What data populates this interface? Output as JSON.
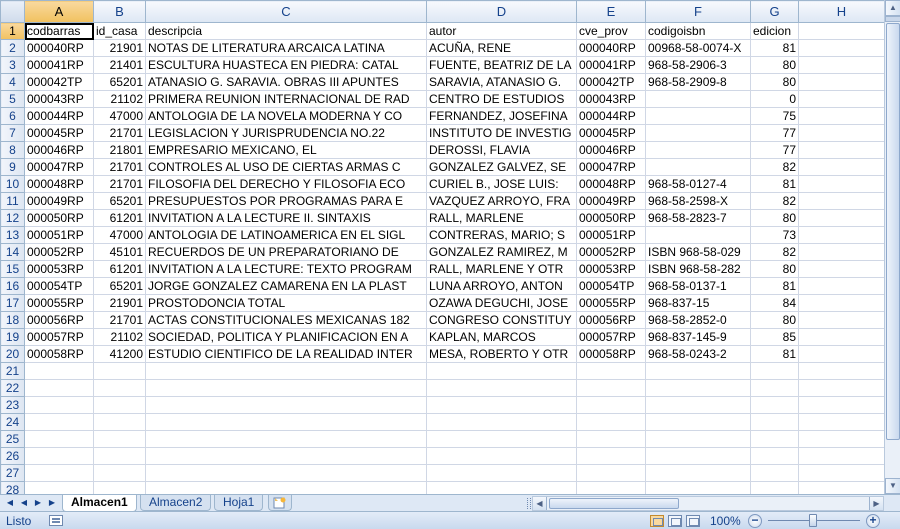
{
  "columns": [
    "A",
    "B",
    "C",
    "D",
    "E",
    "F",
    "G",
    "H"
  ],
  "rows": [
    [
      "codbarras",
      "id_casa",
      "descripcia",
      "autor",
      "cve_prov",
      "codigoisbn",
      "edicion",
      ""
    ],
    [
      "000040RP",
      "21901",
      "NOTAS DE LITERATURA ARCAICA LATINA",
      "ACUÑA, RENE",
      "000040RP",
      "00968-58-0074-X",
      "81",
      ""
    ],
    [
      "000041RP",
      "21401",
      "ESCULTURA HUASTECA EN PIEDRA: CATAL",
      "FUENTE, BEATRIZ DE LA",
      "000041RP",
      "968-58-2906-3",
      "80",
      ""
    ],
    [
      "000042TP",
      "65201",
      "ATANASIO G. SARAVIA. OBRAS III APUNTES",
      "SARAVIA, ATANASIO G.",
      "000042TP",
      "968-58-2909-8",
      "80",
      ""
    ],
    [
      "000043RP",
      "21102",
      "PRIMERA REUNION INTERNACIONAL DE RAD",
      "CENTRO DE ESTUDIOS",
      "000043RP",
      "",
      "0",
      ""
    ],
    [
      "000044RP",
      "47000",
      "ANTOLOGIA DE LA NOVELA MODERNA Y CO",
      "FERNANDEZ, JOSEFINA",
      "000044RP",
      "",
      "75",
      ""
    ],
    [
      "000045RP",
      "21701",
      "LEGISLACION Y JURISPRUDENCIA NO.22",
      "INSTITUTO DE INVESTIG",
      "000045RP",
      "",
      "77",
      ""
    ],
    [
      "000046RP",
      "21801",
      "EMPRESARIO MEXICANO, EL",
      "DEROSSI, FLAVIA",
      "000046RP",
      "",
      "77",
      ""
    ],
    [
      "000047RP",
      "21701",
      "CONTROLES AL USO DE CIERTAS ARMAS C",
      "GONZALEZ GALVEZ, SE",
      "000047RP",
      "",
      "82",
      ""
    ],
    [
      "000048RP",
      "21701",
      "FILOSOFIA DEL DERECHO Y FILOSOFIA ECO",
      "CURIEL B., JOSE LUIS:",
      "000048RP",
      "968-58-0127-4",
      "81",
      ""
    ],
    [
      "000049RP",
      "65201",
      "PRESUPUESTOS POR PROGRAMAS PARA E",
      "VAZQUEZ ARROYO, FRA",
      "000049RP",
      "968-58-2598-X",
      "82",
      ""
    ],
    [
      "000050RP",
      "61201",
      "INVITATION A LA LECTURE II. SINTAXIS",
      "RALL, MARLENE",
      "000050RP",
      "968-58-2823-7",
      "80",
      ""
    ],
    [
      "000051RP",
      "47000",
      "ANTOLOGIA DE LATINOAMERICA EN EL SIGL",
      "CONTRERAS, MARIO; S",
      "000051RP",
      "",
      "73",
      ""
    ],
    [
      "000052RP",
      "45101",
      "RECUERDOS DE UN PREPARATORIANO DE",
      "GONZALEZ RAMIREZ, M",
      "000052RP",
      "ISBN 968-58-029",
      "82",
      ""
    ],
    [
      "000053RP",
      "61201",
      "INVITATION A LA LECTURE: TEXTO PROGRAM",
      "RALL, MARLENE Y OTR",
      "000053RP",
      "ISBN 968-58-282",
      "80",
      ""
    ],
    [
      "000054TP",
      "65201",
      "JORGE GONZALEZ CAMARENA EN LA PLAST",
      "LUNA ARROYO, ANTON",
      "000054TP",
      "968-58-0137-1",
      "81",
      ""
    ],
    [
      "000055RP",
      "21901",
      "PROSTODONCIA TOTAL",
      "OZAWA DEGUCHI, JOSE",
      "000055RP",
      "968-837-15",
      "84",
      ""
    ],
    [
      "000056RP",
      "21701",
      "ACTAS CONSTITUCIONALES MEXICANAS 182",
      "CONGRESO CONSTITUY",
      "000056RP",
      "968-58-2852-0",
      "80",
      ""
    ],
    [
      "000057RP",
      "21102",
      "SOCIEDAD, POLITICA Y PLANIFICACION EN A",
      "KAPLAN, MARCOS",
      "000057RP",
      "968-837-145-9",
      "85",
      ""
    ],
    [
      "000058RP",
      "41200",
      "ESTUDIO CIENTIFICO DE LA REALIDAD INTER",
      "MESA, ROBERTO Y OTR",
      "000058RP",
      "968-58-0243-2",
      "81",
      ""
    ],
    [
      "",
      "",
      "",
      "",
      "",
      "",
      "",
      ""
    ],
    [
      "",
      "",
      "",
      "",
      "",
      "",
      "",
      ""
    ],
    [
      "",
      "",
      "",
      "",
      "",
      "",
      "",
      ""
    ],
    [
      "",
      "",
      "",
      "",
      "",
      "",
      "",
      ""
    ],
    [
      "",
      "",
      "",
      "",
      "",
      "",
      "",
      ""
    ],
    [
      "",
      "",
      "",
      "",
      "",
      "",
      "",
      ""
    ],
    [
      "",
      "",
      "",
      "",
      "",
      "",
      "",
      ""
    ],
    [
      "",
      "",
      "",
      "",
      "",
      "",
      "",
      ""
    ]
  ],
  "sheet_tabs": {
    "tab1": "Almacen1",
    "tab2": "Almacen2",
    "tab3": "Hoja1"
  },
  "status": {
    "text": "Listo",
    "zoom": "100%",
    "zoom_out": "−",
    "zoom_in": "+"
  },
  "active_cell": "A1",
  "icons": {
    "nav_first": "nav-first-icon",
    "nav_prev": "nav-prev-icon",
    "nav_next": "nav-next-icon",
    "nav_last": "nav-last-icon",
    "new_sheet": "insert-sheet-icon",
    "macro": "macro-record-icon"
  },
  "colors": {
    "header_bg": "#dde7f4",
    "header_text": "#15428b",
    "selected_header": "#f1c15f",
    "gridline": "#d0d7e5",
    "statusbar": "#c9d9ee"
  }
}
